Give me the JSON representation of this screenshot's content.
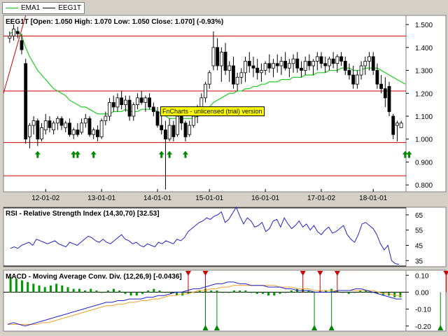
{
  "legend": [
    {
      "name": "EMA1",
      "color": "#22bb22"
    },
    {
      "name": "EEG1T",
      "color": "#000000"
    }
  ],
  "watermark": "FnCharts - unlicensed (trial) version",
  "colors": {
    "up": "#ffffff",
    "down": "#000000",
    "ema": "#22cc22",
    "rsi": "#2222cc",
    "macd": "#2222cc",
    "signal": "#f0a030",
    "hist": "#009900",
    "hline": "#cc0000",
    "buy": "#008800",
    "sell": "#cc0000"
  },
  "chart_data": [
    {
      "type": "candlestick",
      "title": "EEG1T [Open: 1.050  High: 1.070  Low: 1.050  Close: 1.070] (-0.93%)",
      "ylim": [
        0.77,
        1.54
      ],
      "y_ticks": [
        0.8,
        0.9,
        1.0,
        1.1,
        1.2,
        1.3,
        1.4,
        1.5
      ],
      "y_tick_labels": [
        "0.800",
        "0.900",
        "1.000",
        "1.100",
        "1.200",
        "1.300",
        "1.400",
        "1.500"
      ],
      "x_tick_labels": [
        "12-01-02",
        "13-01-01",
        "14-01-01",
        "15-01-01",
        "16-01-01",
        "17-01-02",
        "18-01-01"
      ],
      "x_tick_index": [
        9,
        23,
        37,
        50,
        64,
        78,
        91
      ],
      "horizontal_lines": [
        1.45,
        1.21,
        0.985,
        0.84
      ],
      "buy_signal_index": [
        7,
        16,
        17,
        21,
        38,
        40,
        44,
        99,
        100
      ],
      "ohlc": [
        [
          1.44,
          1.47,
          1.42,
          1.45
        ],
        [
          1.45,
          1.5,
          1.43,
          1.48
        ],
        [
          1.47,
          1.49,
          1.44,
          1.46
        ],
        [
          1.43,
          1.46,
          1.37,
          1.39
        ],
        [
          1.33,
          1.35,
          0.98,
          1.0
        ],
        [
          1.01,
          1.07,
          0.96,
          1.06
        ],
        [
          1.06,
          1.1,
          1.02,
          1.08
        ],
        [
          1.08,
          1.09,
          0.97,
          1.0
        ],
        [
          1.0,
          1.07,
          0.99,
          1.05
        ],
        [
          1.04,
          1.11,
          1.02,
          1.08
        ],
        [
          1.08,
          1.1,
          1.03,
          1.05
        ],
        [
          1.04,
          1.08,
          1.02,
          1.07
        ],
        [
          1.07,
          1.1,
          1.04,
          1.09
        ],
        [
          1.09,
          1.1,
          1.04,
          1.06
        ],
        [
          1.05,
          1.08,
          1.03,
          1.07
        ],
        [
          1.07,
          1.09,
          1.01,
          1.02
        ],
        [
          1.02,
          1.05,
          1.0,
          1.04
        ],
        [
          1.04,
          1.07,
          1.01,
          1.02
        ],
        [
          1.03,
          1.09,
          1.02,
          1.07
        ],
        [
          1.07,
          1.11,
          1.05,
          1.09
        ],
        [
          1.09,
          1.1,
          1.01,
          1.02
        ],
        [
          1.02,
          1.05,
          1.0,
          1.04
        ],
        [
          1.04,
          1.06,
          0.99,
          1.01
        ],
        [
          1.01,
          1.09,
          1.0,
          1.08
        ],
        [
          1.08,
          1.12,
          1.06,
          1.1
        ],
        [
          1.1,
          1.18,
          1.08,
          1.16
        ],
        [
          1.16,
          1.19,
          1.12,
          1.14
        ],
        [
          1.14,
          1.2,
          1.12,
          1.18
        ],
        [
          1.18,
          1.21,
          1.13,
          1.15
        ],
        [
          1.15,
          1.19,
          1.12,
          1.17
        ],
        [
          1.17,
          1.19,
          1.08,
          1.1
        ],
        [
          1.1,
          1.16,
          1.08,
          1.15
        ],
        [
          1.15,
          1.2,
          1.13,
          1.18
        ],
        [
          1.18,
          1.21,
          1.15,
          1.16
        ],
        [
          1.16,
          1.19,
          1.12,
          1.18
        ],
        [
          1.18,
          1.2,
          1.13,
          1.14
        ],
        [
          1.14,
          1.16,
          1.1,
          1.12
        ],
        [
          1.12,
          1.14,
          1.05,
          1.06
        ],
        [
          1.06,
          1.1,
          1.02,
          1.04
        ],
        [
          1.04,
          1.08,
          0.78,
          1.0
        ],
        [
          1.0,
          1.09,
          0.99,
          1.06
        ],
        [
          1.06,
          1.08,
          0.99,
          1.01
        ],
        [
          1.02,
          1.12,
          1.01,
          1.1
        ],
        [
          1.1,
          1.12,
          1.04,
          1.07
        ],
        [
          1.07,
          1.08,
          0.99,
          1.01
        ],
        [
          1.02,
          1.08,
          1.01,
          1.06
        ],
        [
          1.06,
          1.12,
          1.05,
          1.1
        ],
        [
          1.1,
          1.15,
          1.07,
          1.13
        ],
        [
          1.13,
          1.2,
          1.11,
          1.18
        ],
        [
          1.18,
          1.25,
          1.16,
          1.24
        ],
        [
          1.24,
          1.3,
          1.22,
          1.29
        ],
        [
          1.32,
          1.47,
          1.3,
          1.4
        ],
        [
          1.4,
          1.44,
          1.3,
          1.32
        ],
        [
          1.32,
          1.4,
          1.25,
          1.38
        ],
        [
          1.38,
          1.42,
          1.28,
          1.3
        ],
        [
          1.3,
          1.34,
          1.25,
          1.32
        ],
        [
          1.32,
          1.36,
          1.22,
          1.24
        ],
        [
          1.24,
          1.29,
          1.21,
          1.27
        ],
        [
          1.27,
          1.31,
          1.24,
          1.29
        ],
        [
          1.29,
          1.36,
          1.25,
          1.34
        ],
        [
          1.34,
          1.38,
          1.29,
          1.32
        ],
        [
          1.32,
          1.36,
          1.27,
          1.31
        ],
        [
          1.31,
          1.35,
          1.26,
          1.29
        ],
        [
          1.29,
          1.33,
          1.25,
          1.3
        ],
        [
          1.3,
          1.34,
          1.28,
          1.33
        ],
        [
          1.33,
          1.37,
          1.29,
          1.31
        ],
        [
          1.31,
          1.35,
          1.27,
          1.33
        ],
        [
          1.33,
          1.37,
          1.29,
          1.32
        ],
        [
          1.32,
          1.36,
          1.28,
          1.34
        ],
        [
          1.34,
          1.38,
          1.3,
          1.31
        ],
        [
          1.31,
          1.35,
          1.27,
          1.33
        ],
        [
          1.33,
          1.37,
          1.29,
          1.35
        ],
        [
          1.35,
          1.38,
          1.29,
          1.31
        ],
        [
          1.31,
          1.34,
          1.27,
          1.3
        ],
        [
          1.3,
          1.36,
          1.28,
          1.34
        ],
        [
          1.34,
          1.37,
          1.3,
          1.32
        ],
        [
          1.32,
          1.35,
          1.28,
          1.34
        ],
        [
          1.34,
          1.38,
          1.3,
          1.36
        ],
        [
          1.36,
          1.38,
          1.31,
          1.33
        ],
        [
          1.33,
          1.36,
          1.29,
          1.32
        ],
        [
          1.32,
          1.36,
          1.3,
          1.35
        ],
        [
          1.35,
          1.38,
          1.31,
          1.33
        ],
        [
          1.33,
          1.37,
          1.29,
          1.36
        ],
        [
          1.36,
          1.38,
          1.32,
          1.34
        ],
        [
          1.34,
          1.36,
          1.28,
          1.3
        ],
        [
          1.3,
          1.33,
          1.26,
          1.28
        ],
        [
          1.28,
          1.32,
          1.22,
          1.24
        ],
        [
          1.24,
          1.3,
          1.22,
          1.28
        ],
        [
          1.28,
          1.34,
          1.26,
          1.32
        ],
        [
          1.32,
          1.36,
          1.28,
          1.34
        ],
        [
          1.34,
          1.38,
          1.3,
          1.36
        ],
        [
          1.36,
          1.38,
          1.28,
          1.3
        ],
        [
          1.3,
          1.33,
          1.22,
          1.24
        ],
        [
          1.24,
          1.28,
          1.2,
          1.22
        ],
        [
          1.22,
          1.27,
          1.14,
          1.18
        ],
        [
          1.23,
          1.25,
          1.1,
          1.12
        ],
        [
          1.1,
          1.11,
          1.0,
          1.02
        ],
        [
          1.06,
          1.08,
          0.99,
          1.07
        ],
        [
          1.05,
          1.08,
          1.05,
          1.07
        ]
      ],
      "ema": [
        1.46,
        1.47,
        1.47,
        1.45,
        1.4,
        1.36,
        1.33,
        1.3,
        1.28,
        1.26,
        1.24,
        1.22,
        1.21,
        1.2,
        1.19,
        1.17,
        1.16,
        1.15,
        1.14,
        1.14,
        1.13,
        1.12,
        1.11,
        1.11,
        1.11,
        1.11,
        1.12,
        1.12,
        1.12,
        1.13,
        1.12,
        1.12,
        1.12,
        1.13,
        1.13,
        1.13,
        1.13,
        1.12,
        1.11,
        1.1,
        1.09,
        1.09,
        1.09,
        1.09,
        1.09,
        1.09,
        1.09,
        1.1,
        1.11,
        1.12,
        1.14,
        1.16,
        1.17,
        1.18,
        1.19,
        1.2,
        1.2,
        1.21,
        1.21,
        1.22,
        1.22,
        1.23,
        1.23,
        1.24,
        1.24,
        1.25,
        1.25,
        1.25,
        1.26,
        1.26,
        1.26,
        1.27,
        1.27,
        1.27,
        1.28,
        1.28,
        1.28,
        1.29,
        1.29,
        1.29,
        1.3,
        1.3,
        1.3,
        1.31,
        1.31,
        1.31,
        1.3,
        1.3,
        1.3,
        1.31,
        1.31,
        1.31,
        1.31,
        1.3,
        1.29,
        1.28,
        1.27,
        1.26,
        1.25,
        1.24
      ]
    },
    {
      "type": "line",
      "title": "RSI - Relative Strength Index (14,30,70) [32.53]",
      "ylim": [
        31,
        70
      ],
      "y_ticks": [
        35,
        45,
        55,
        65
      ],
      "y_tick_labels": [
        "35",
        "45",
        "55",
        "65"
      ],
      "levels": [
        30,
        70
      ],
      "series": [
        {
          "values": [
            43,
            44,
            43,
            45,
            46,
            47,
            45,
            49,
            48,
            47,
            46,
            47,
            48,
            46,
            45,
            44,
            47,
            46,
            45,
            47,
            49,
            51,
            50,
            48,
            47,
            49,
            47,
            46,
            48,
            50,
            52,
            49,
            48,
            46,
            47,
            45,
            44,
            46,
            45,
            44,
            47,
            46,
            48,
            47,
            46,
            49,
            48,
            50,
            54,
            56,
            58,
            60,
            61,
            63,
            62,
            64,
            65,
            67,
            60,
            62,
            66,
            70,
            64,
            59,
            63,
            61,
            57,
            58,
            60,
            54,
            56,
            61,
            62,
            57,
            63,
            59,
            56,
            58,
            61,
            57,
            59,
            55,
            58,
            54,
            52,
            55,
            57,
            53,
            54,
            56,
            58,
            52,
            49,
            47,
            52,
            59,
            60,
            58,
            56,
            52,
            46,
            42,
            45,
            35,
            33,
            32.53
          ]
        }
      ]
    },
    {
      "type": "line",
      "title": "MACD - Moving Average Conv. Div. (12,26,9) [-0.0436]",
      "ylim": [
        -0.23,
        0.13
      ],
      "y_ticks": [
        0.1,
        0.0,
        -0.1,
        -0.2
      ],
      "y_tick_labels": [
        "0.10",
        "0.00",
        "-0.10",
        "-0.20"
      ],
      "series": [
        {
          "values": [
            -0.19,
            -0.18,
            -0.19,
            -0.2,
            -0.19,
            -0.18,
            -0.17,
            -0.16,
            -0.15,
            -0.14,
            -0.13,
            -0.12,
            -0.11,
            -0.1,
            -0.09,
            -0.08,
            -0.07,
            -0.06,
            -0.06,
            -0.05,
            -0.05,
            -0.04,
            -0.04,
            -0.04,
            -0.03,
            -0.03,
            -0.02,
            -0.02,
            -0.01,
            0.0,
            0.0,
            0.01,
            0.02,
            0.02,
            0.03,
            0.04,
            0.05,
            0.05,
            0.06,
            0.06,
            0.05,
            0.05,
            0.04,
            0.04,
            0.04,
            0.03,
            0.03,
            0.03,
            0.02,
            0.02,
            0.01,
            0.01,
            0.01,
            0.0,
            0.0,
            0.0,
            0.0,
            0.01,
            0.01,
            0.01,
            0.02,
            0.02,
            0.01,
            0.0,
            -0.01,
            -0.02,
            -0.03,
            -0.04,
            -0.04
          ]
        },
        {
          "values": [
            -0.19,
            -0.19,
            -0.19,
            -0.19,
            -0.19,
            -0.19,
            -0.18,
            -0.18,
            -0.17,
            -0.16,
            -0.15,
            -0.14,
            -0.13,
            -0.12,
            -0.11,
            -0.1,
            -0.09,
            -0.08,
            -0.08,
            -0.07,
            -0.07,
            -0.06,
            -0.06,
            -0.05,
            -0.05,
            -0.04,
            -0.04,
            -0.03,
            -0.02,
            -0.02,
            -0.01,
            -0.01,
            0.0,
            0.01,
            0.01,
            0.02,
            0.02,
            0.03,
            0.03,
            0.04,
            0.04,
            0.04,
            0.04,
            0.04,
            0.04,
            0.04,
            0.04,
            0.03,
            0.03,
            0.03,
            0.02,
            0.02,
            0.02,
            0.01,
            0.01,
            0.01,
            0.01,
            0.01,
            0.01,
            0.01,
            0.01,
            0.01,
            0.01,
            0.01,
            0.0,
            -0.01,
            -0.01,
            -0.02,
            -0.02
          ]
        }
      ],
      "histogram": [
        0.09,
        0.08,
        0.07,
        0.06,
        0.05,
        0.04,
        0.03,
        0.04,
        0.05,
        0.04,
        0.03,
        0.02,
        0.02,
        0.01,
        0.02,
        0.01,
        0.0,
        0.01,
        0.02,
        0.01,
        -0.01,
        -0.02,
        -0.02,
        -0.01,
        0.01,
        0.02,
        0.01,
        0.0,
        -0.01,
        -0.02,
        -0.02,
        -0.01,
        0.0,
        0.01,
        0.02,
        0.01,
        0.01,
        0.0,
        0.0,
        0.01,
        0.01,
        0.01,
        0.0,
        -0.01,
        -0.01,
        -0.02,
        -0.02,
        -0.01,
        0.0,
        0.01,
        0.02,
        0.02,
        0.01,
        0.0,
        0.01,
        0.01,
        0.02,
        0.01,
        0.0,
        -0.01,
        0.0,
        0.01,
        0.01,
        0.0,
        -0.01,
        -0.02,
        -0.02,
        -0.03,
        -0.03
      ],
      "sell_signal_index": [
        31,
        34,
        51,
        54,
        57,
        76
      ],
      "buy_signal_index": [
        34,
        36,
        53,
        56,
        75
      ]
    }
  ]
}
